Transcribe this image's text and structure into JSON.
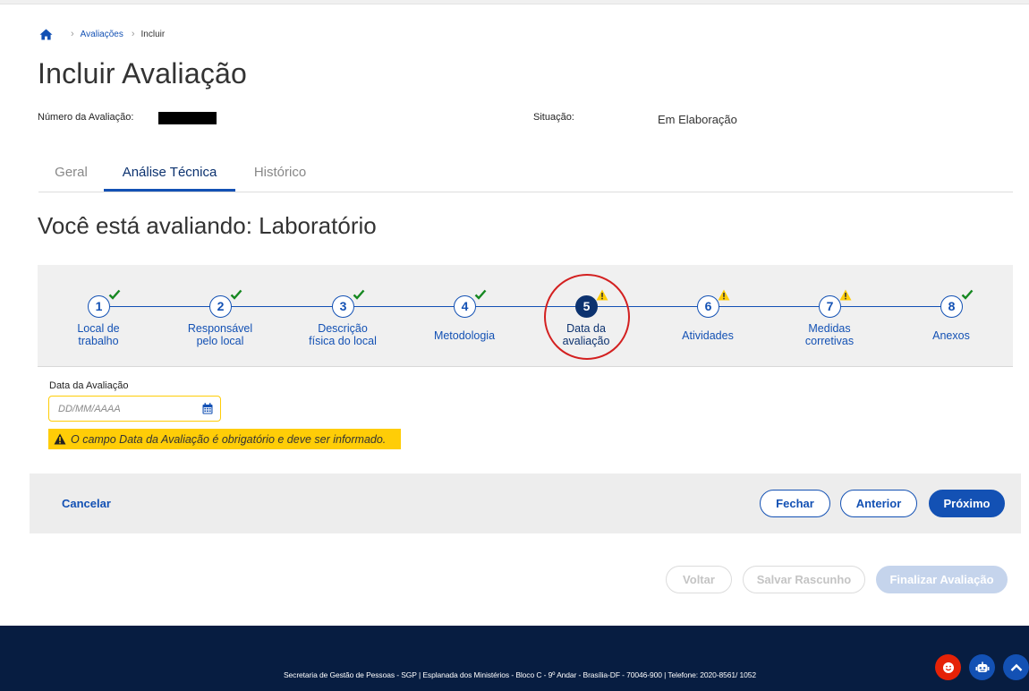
{
  "breadcrumb": {
    "home_icon": "home-icon",
    "items": [
      {
        "label": "Avaliações"
      },
      {
        "label": "Incluir"
      }
    ]
  },
  "page": {
    "title": "Incluir Avaliação",
    "numero_label": "Número da Avaliação:",
    "situacao_label": "Situação:",
    "situacao_value": "Em Elaboração"
  },
  "tabs": [
    {
      "label": "Geral",
      "active": false
    },
    {
      "label": "Análise Técnica",
      "active": true
    },
    {
      "label": "Histórico",
      "active": false
    }
  ],
  "evaluating": {
    "title": "Você está avaliando: Laboratório"
  },
  "stepper": {
    "current_step": 5,
    "steps": [
      {
        "number": "1",
        "line1": "Local de",
        "line2": "trabalho",
        "status": "complete"
      },
      {
        "number": "2",
        "line1": "Responsável",
        "line2": "pelo local",
        "status": "complete"
      },
      {
        "number": "3",
        "line1": "Descrição",
        "line2": "física do local",
        "status": "complete"
      },
      {
        "number": "4",
        "line1": "Metodologia",
        "line2": "",
        "status": "complete"
      },
      {
        "number": "5",
        "line1": "Data da",
        "line2": "avaliação",
        "status": "warning"
      },
      {
        "number": "6",
        "line1": "Atividades",
        "line2": "",
        "status": "warning"
      },
      {
        "number": "7",
        "line1": "Medidas",
        "line2": "corretivas",
        "status": "warning"
      },
      {
        "number": "8",
        "line1": "Anexos",
        "line2": "",
        "status": "complete"
      }
    ]
  },
  "form": {
    "date_label": "Data da Avaliação",
    "date_placeholder": "DD/MM/AAAA",
    "date_value": "",
    "error_message": "O campo Data da Avaliação é obrigatório e deve ser informado."
  },
  "actions": {
    "cancel_label": "Cancelar",
    "close_label": "Fechar",
    "previous_label": "Anterior",
    "next_label": "Próximo"
  },
  "bottom_actions": {
    "back_label": "Voltar",
    "save_draft_label": "Salvar Rascunho",
    "finalize_label": "Finalizar Avaliação"
  },
  "footer": {
    "text": "Secretaria de Gestão de Pessoas - SGP | Esplanada dos Ministérios - Bloco C - 9º Andar - Brasília-DF - 70046-900 | Telefone: 2020-8561/ 1052"
  },
  "colors": {
    "primary": "#1351b4",
    "primary_dark": "#0c326f",
    "warning": "#ffcd07",
    "success": "#168821",
    "footer_bg": "#071d41",
    "highlight": "#d32020"
  }
}
